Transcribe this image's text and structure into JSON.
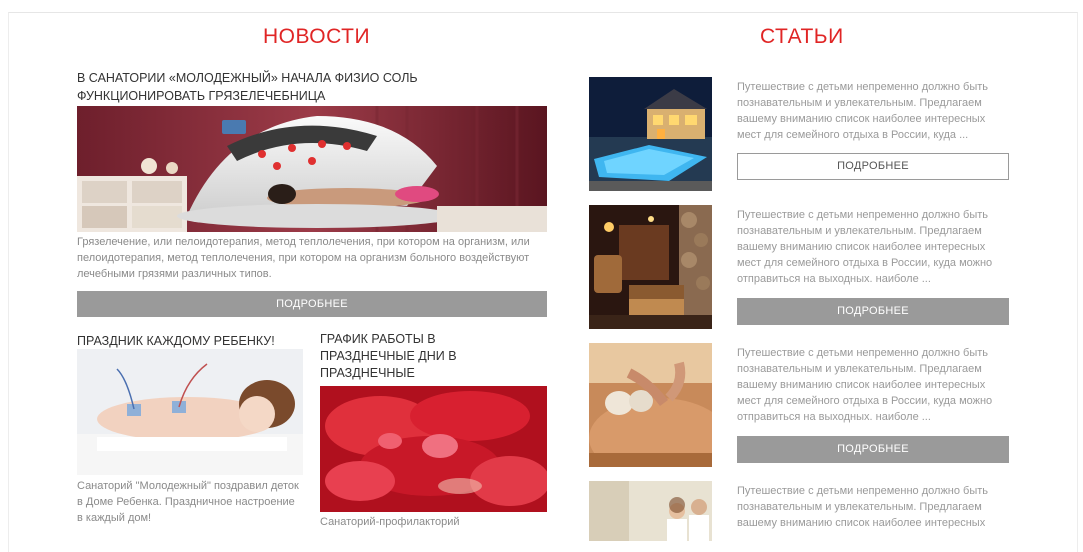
{
  "news": {
    "heading": "НОВОСТИ",
    "main": {
      "title": "В САНАТОРИИ «МОЛОДЕЖНЫЙ» НАЧАЛА ФИЗИО СОЛЬ ФУНКЦИОНИРОВАТЬ ГРЯЗЕЛЕЧЕБНИЦА",
      "description": "Грязелечение, или пелоидотерапия, метод теплолечения, при котором на организм, или пелоидотерапия, метод теплолечения, при котором на организм больного воздействуют лечебными грязями различных типов.",
      "button": "ПОДРОБНЕЕ"
    },
    "items": [
      {
        "title": "ПРАЗДНИК КАЖДОМУ РЕБЕНКУ!",
        "description": "Санаторий \"Молодежный\" поздравил деток в Доме Ребенка. Праздничное настроение в каждый дом!"
      },
      {
        "title": "ГРАФИК РАБОТЫ В ПРАЗДНЕЧНЫЕ ДНИ В ПРАЗДНЕЧНЫЕ",
        "description": "Санаторий-профилакторий"
      }
    ]
  },
  "articles": {
    "heading": "СТАТЬИ",
    "items": [
      {
        "text": "Путешествие с детьми непременно должно быть познавательным и увлекательным. Предлагаем вашему вниманию список наиболее интересных мест для семейного отдыха в России, куда ...",
        "button": "ПОДРОБНЕЕ"
      },
      {
        "text": "Путешествие с детьми непременно должно быть познавательным и увлекательным. Предлагаем вашему вниманию список наиболее интересных мест для семейного отдыха в России, куда можно отправиться на выходных. наиболе ...",
        "button": "ПОДРОБНЕЕ"
      },
      {
        "text": "Путешествие с детьми непременно должно быть познавательным и увлекательным. Предлагаем вашему вниманию список наиболее интересных мест для семейного отдыха в России, куда можно отправиться на выходных. наиболе ...",
        "button": "ПОДРОБНЕЕ"
      },
      {
        "text": "Путешествие с детьми непременно должно быть познавательным и увлекательным. Предлагаем вашему вниманию список наиболее интересных"
      }
    ]
  },
  "colors": {
    "accent": "#e02525",
    "button": "#9a9a9a",
    "muted_text": "#8a8a8a"
  }
}
